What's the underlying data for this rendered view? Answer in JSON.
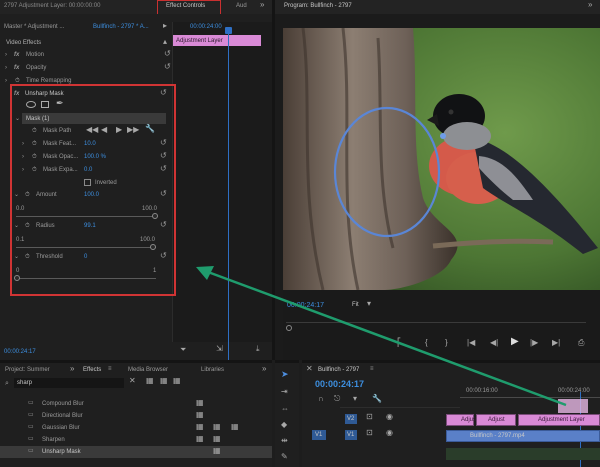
{
  "tabs": {
    "panel_prefix": "2797 Adjustment Layer: 00:00:00:00",
    "effect_controls": "Effect Controls",
    "audio": "Aud",
    "program": "Program: Bullfinch - 2797"
  },
  "ec_header": {
    "master": "Master * Adjustment ...",
    "sequence": "Bullfinch - 2797 * A...",
    "timecode": "00:00:24:00",
    "layer_label": "Adjustment Layer"
  },
  "effects_tree": {
    "video_effects": "Video Effects",
    "motion": "Motion",
    "opacity": "Opacity",
    "time_remapping": "Time Remapping",
    "unsharp_mask": "Unsharp Mask",
    "mask_name": "Mask (1)",
    "mask_path": "Mask Path",
    "mask_feather": "Mask Feat...",
    "mask_feather_value": "10.0",
    "mask_opacity": "Mask Opac...",
    "mask_opacity_value": "100.0 %",
    "mask_expansion": "Mask Expa...",
    "mask_expansion_value": "0.0",
    "inverted": "Inverted",
    "amount": "Amount",
    "amount_value": "100.0",
    "amount_min": "0.0",
    "amount_max": "100.0",
    "radius": "Radius",
    "radius_value": "99.1",
    "radius_min": "0.1",
    "radius_max": "100.0",
    "threshold": "Threshold",
    "threshold_value": "0",
    "threshold_min": "0",
    "threshold_max": "1"
  },
  "ec_footer_timecode": "00:00:24:17",
  "monitor": {
    "timecode": "00:00:24:17",
    "fit": "Fit"
  },
  "lower_tabs": {
    "project": "Project: Summer",
    "effects": "Effects",
    "media_browser": "Media Browser",
    "libraries": "Libraries"
  },
  "effects_search": "sharp",
  "effects_list": [
    "Compound Blur",
    "Directional Blur",
    "Gaussian Blur",
    "Sharpen",
    "Unsharp Mask"
  ],
  "sequence": {
    "title": "Bullfinch - 2797",
    "timecode": "00:00:24:17",
    "ruler": [
      "00:00:16:00",
      "00:00:24:00"
    ],
    "track_v1": "V1",
    "track_v2": "V2",
    "clip_adjustment": "Adjustment Layer",
    "clip_adjust_short": "Adjust",
    "clip_adjust_short2": "Adjust",
    "clip_footage": "Bullfinch - 2797.mp4"
  }
}
